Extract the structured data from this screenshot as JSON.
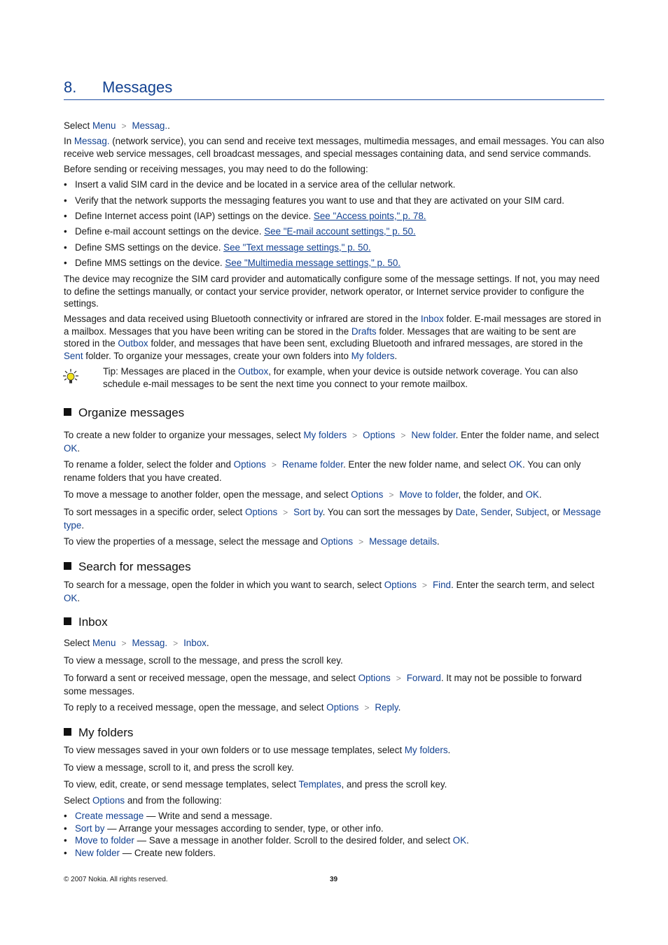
{
  "chapter": {
    "number": "8.",
    "title": "Messages"
  },
  "intro": {
    "select_prefix": "Select ",
    "path": [
      "Menu",
      "Messag."
    ],
    "path_suffix": ".",
    "p1_prefix": "In ",
    "p1_link": "Messag.",
    "p1_text": " (network service), you can send and receive text messages, multimedia messages, and email messages. You can also receive web service messages, cell broadcast messages, and special messages containing data, and send service commands.",
    "p2": "Before sending or receiving messages, you may need to do the following:",
    "bullets": [
      {
        "text": "Insert a valid SIM card in the device and be located in a service area of the cellular network.",
        "link": ""
      },
      {
        "text": "Verify that the network supports the messaging features you want to use and that they are activated on your SIM card.",
        "link": ""
      },
      {
        "text": "Define Internet access point (IAP) settings on the device. ",
        "link": "See \"Access points,\" p. 78."
      },
      {
        "text": "Define e-mail account settings on the device. ",
        "link": "See \"E-mail account settings,\" p. 50."
      },
      {
        "text": "Define SMS settings on the device. ",
        "link": "See \"Text message settings,\" p. 50."
      },
      {
        "text": "Define MMS settings on the device. ",
        "link": "See \"Multimedia message settings,\" p. 50."
      }
    ],
    "p3": "The device may recognize the SIM card provider and automatically configure some of the message settings. If not, you may need to define the settings manually, or contact your service provider, network operator, or Internet service provider to configure the settings.",
    "p4": {
      "t1": "Messages and data received using Bluetooth connectivity or infrared are stored in the ",
      "l1": "Inbox",
      "t2": " folder. E-mail messages are stored in a mailbox. Messages that you have been writing can be stored in the ",
      "l2": "Drafts",
      "t3": " folder. Messages that are waiting to be sent are stored in the ",
      "l3": "Outbox",
      "t4": " folder, and messages that have been sent, excluding Bluetooth and infrared messages, are stored in the ",
      "l4": "Sent",
      "t5": " folder. To organize your messages, create your own folders into ",
      "l5": "My folders",
      "t6": "."
    },
    "tip": {
      "icon": "lightbulb-icon",
      "label": "Tip:",
      "t1": " Messages are placed in the ",
      "l1": "Outbox",
      "t2": ", for example, when your device is outside network coverage. You can also schedule e-mail messages to be sent the next time you connect to your remote mailbox."
    }
  },
  "organize": {
    "heading": "Organize messages",
    "p1": {
      "t1": "To create a new folder to organize your messages, select ",
      "l1": "My folders",
      "l2": "Options",
      "l3": "New folder",
      "t2": ". Enter the folder name, and select ",
      "l4": "OK",
      "t3": "."
    },
    "p2": {
      "t1": "To rename a folder, select the folder and ",
      "l1": "Options",
      "l2": "Rename folder",
      "t2": ". Enter the new folder name, and select ",
      "l3": "OK",
      "t3": ". You can only rename folders that you have created."
    },
    "p3": {
      "t1": "To move a message to another folder, open the message, and select ",
      "l1": "Options",
      "l2": "Move to folder",
      "t2": ", the folder, and ",
      "l3": "OK",
      "t3": "."
    },
    "p4": {
      "t1": "To sort messages in a specific order, select ",
      "l1": "Options",
      "l2": "Sort by",
      "t2": ". You can sort the messages by ",
      "l3": "Date",
      "c1": ", ",
      "l4": "Sender",
      "c2": ", ",
      "l5": "Subject",
      "c3": ", or ",
      "l6": "Message type",
      "t3": "."
    },
    "p5": {
      "t1": "To view the properties of a message, select the message and ",
      "l1": "Options",
      "l2": "Message details",
      "t2": "."
    }
  },
  "search": {
    "heading": "Search for messages",
    "p1": {
      "t1": "To search for a message, open the folder in which you want to search, select ",
      "l1": "Options",
      "l2": "Find",
      "t2": ". Enter the search term, and select ",
      "l3": "OK",
      "t3": "."
    }
  },
  "inbox": {
    "heading": "Inbox",
    "p1": {
      "t1": "Select ",
      "l1": "Menu",
      "l2": "Messag.",
      "l3": "Inbox",
      "t2": "."
    },
    "p2": "To view a message, scroll to the message, and press the scroll key.",
    "p3": {
      "t1": "To forward a sent or received message, open the message, and select ",
      "l1": "Options",
      "l2": "Forward",
      "t2": ". It may not be possible to forward some messages."
    },
    "p4": {
      "t1": "To reply to a received message, open the message, and select ",
      "l1": "Options",
      "l2": "Reply",
      "t2": "."
    }
  },
  "myfolders": {
    "heading": "My folders",
    "p1": {
      "t1": "To view messages saved in your own folders or to use message templates, select ",
      "l1": "My folders",
      "t2": "."
    },
    "p2": "To view a message, scroll to it, and press the scroll key.",
    "p3": {
      "t1": "To view, edit, create, or send message templates, select ",
      "l1": "Templates",
      "t2": ", and press the scroll key."
    },
    "p4": {
      "t1": "Select ",
      "l1": "Options",
      "t2": " and from the following:"
    },
    "options": [
      {
        "label": "Create message",
        "desc": " — Write and send a message.",
        "ok": "",
        "end": ""
      },
      {
        "label": "Sort by",
        "desc": " — Arrange your messages according to sender, type, or other info.",
        "ok": "",
        "end": ""
      },
      {
        "label": "Move to folder",
        "desc": " — Save a message in another folder. Scroll to the desired folder, and select ",
        "ok": "OK",
        "end": "."
      },
      {
        "label": "New folder",
        "desc": " — Create new folders.",
        "ok": "",
        "end": ""
      }
    ]
  },
  "footer": {
    "copyright": "© 2007 Nokia. All rights reserved.",
    "page_number": "39"
  },
  "colors": {
    "link": "#124191",
    "heading_rule": "#1f4fa3"
  }
}
